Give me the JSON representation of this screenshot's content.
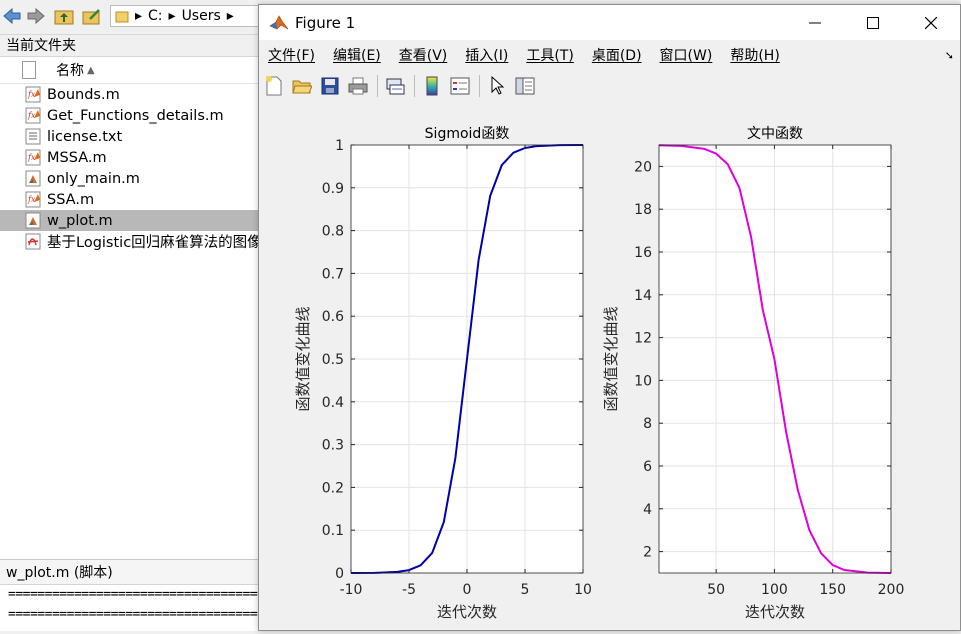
{
  "explorer": {
    "path_segments": [
      "C:",
      "Users"
    ],
    "current_folder_label": "当前文件夹",
    "name_column": "名称",
    "files": [
      {
        "name": "Bounds.m",
        "type": "func",
        "selected": false
      },
      {
        "name": "Get_Functions_details.m",
        "type": "func",
        "selected": false
      },
      {
        "name": "license.txt",
        "type": "text",
        "selected": false
      },
      {
        "name": "MSSA.m",
        "type": "func",
        "selected": false
      },
      {
        "name": "only_main.m",
        "type": "script",
        "selected": false
      },
      {
        "name": "SSA.m",
        "type": "func",
        "selected": false
      },
      {
        "name": "w_plot.m",
        "type": "script",
        "selected": true
      },
      {
        "name": "基于Logistic回归麻雀算法的图像",
        "type": "pdf",
        "selected": false
      }
    ],
    "details_title": "w_plot.m  (脚本)",
    "details_lines": [
      "====================================",
      "===================================="
    ]
  },
  "figure": {
    "title": "Figure 1",
    "menus": [
      "文件(F)",
      "编辑(E)",
      "查看(V)",
      "插入(I)",
      "工具(T)",
      "桌面(D)",
      "窗口(W)",
      "帮助(H)"
    ],
    "toolbar_icons": [
      "new-figure-icon",
      "open-file-icon",
      "save-icon",
      "print-icon",
      "link-plot-icon",
      "colorbar-icon",
      "legend-icon",
      "pointer-icon",
      "property-editor-icon"
    ]
  },
  "chart_data": [
    {
      "type": "line",
      "title": "Sigmoid函数",
      "xlabel": "迭代次数",
      "ylabel": "函数值变化曲线",
      "xlim": [
        -10,
        10
      ],
      "ylim": [
        0,
        1
      ],
      "xticks": [
        -10,
        -5,
        0,
        5,
        10
      ],
      "yticks": [
        0,
        0.1,
        0.2,
        0.3,
        0.4,
        0.5,
        0.6,
        0.7,
        0.8,
        0.9,
        1
      ],
      "grid": true,
      "color": "#0000aa",
      "series": [
        {
          "x": [
            -10,
            -8,
            -6,
            -5,
            -4,
            -3,
            -2,
            -1,
            0,
            1,
            2,
            3,
            4,
            5,
            6,
            8,
            10
          ],
          "y": [
            5e-05,
            0.0003,
            0.0025,
            0.0067,
            0.018,
            0.047,
            0.119,
            0.269,
            0.5,
            0.731,
            0.881,
            0.953,
            0.982,
            0.993,
            0.9975,
            0.9997,
            0.99995
          ]
        }
      ]
    },
    {
      "type": "line",
      "title": "文中函数",
      "xlabel": "迭代次数",
      "ylabel": "函数值变化曲线",
      "xlim": [
        1,
        200
      ],
      "ylim": [
        1,
        21
      ],
      "xticks": [
        50,
        100,
        150,
        200
      ],
      "yticks": [
        2,
        4,
        6,
        8,
        10,
        12,
        14,
        16,
        18,
        20
      ],
      "grid": true,
      "color": "#dd00dd",
      "series": [
        {
          "x": [
            1,
            20,
            40,
            50,
            60,
            70,
            80,
            90,
            100,
            110,
            120,
            130,
            140,
            150,
            160,
            180,
            200
          ],
          "y": [
            20.99,
            20.96,
            20.82,
            20.6,
            20.1,
            19.0,
            16.7,
            13.3,
            11.0,
            7.6,
            4.9,
            3.0,
            1.92,
            1.37,
            1.14,
            1.02,
            1.0
          ]
        }
      ]
    }
  ]
}
